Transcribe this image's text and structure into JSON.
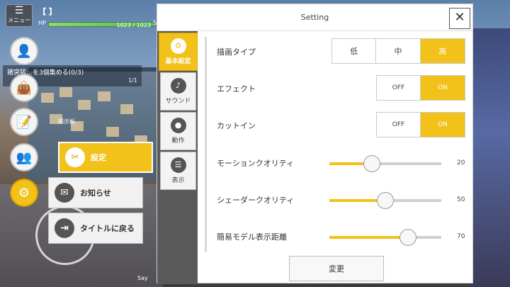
{
  "hud": {
    "menu_label": "メニュー",
    "player_name": "【 】",
    "hp_label": "HP",
    "hp_text": "1023 / 1023",
    "hp_fraction": 1.0,
    "sp_mark": "S",
    "quest_text": "猪突猛…を3個集める(0/3)",
    "quest_count": "1/1",
    "board_label": "掲示板",
    "bottom_text": "Say"
  },
  "sub_menu": {
    "settings": "設定",
    "news": "お知らせ",
    "back_to_title": "タイトルに戻る"
  },
  "dialog": {
    "title": "Setting",
    "close_glyph": "✕",
    "tabs": [
      {
        "label": "基本設定",
        "active": true
      },
      {
        "label": "サウンド",
        "active": false
      },
      {
        "label": "動作",
        "active": false
      },
      {
        "label": "表示",
        "active": false
      }
    ],
    "rows": {
      "draw_type": {
        "label": "描画タイプ",
        "options": [
          "低",
          "中",
          "高"
        ],
        "selected": "高"
      },
      "effect": {
        "label": "エフェクト",
        "options": [
          "OFF",
          "ON"
        ],
        "selected": "ON"
      },
      "cut_in": {
        "label": "カットイン",
        "options": [
          "OFF",
          "ON"
        ],
        "selected": "ON"
      },
      "motion_quality": {
        "label": "モーションクオリティ",
        "value": "20",
        "fraction": 0.38
      },
      "shader_quality": {
        "label": "シェーダークオリティ",
        "value": "50",
        "fraction": 0.5
      },
      "model_distance": {
        "label": "簡易モデル表示距離",
        "value": "70",
        "fraction": 0.7
      }
    },
    "change_label": "変更"
  },
  "colors": {
    "accent": "#f2c21a",
    "tab_column": "#5a5a5a"
  }
}
